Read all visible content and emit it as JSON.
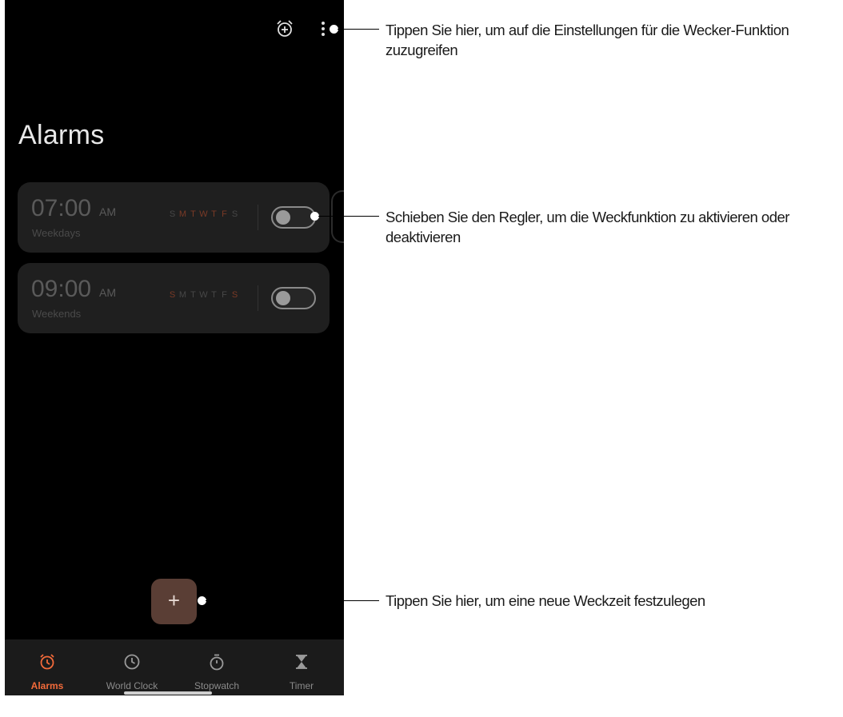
{
  "screen": {
    "title": "Alarms",
    "add_button_label": "+"
  },
  "alarms": [
    {
      "time": "07:00",
      "ampm": "AM",
      "label": "Weekdays",
      "days": [
        "S",
        "M",
        "T",
        "W",
        "T",
        "F",
        "S"
      ],
      "active_days": [
        false,
        true,
        true,
        true,
        true,
        true,
        false
      ],
      "enabled": false
    },
    {
      "time": "09:00",
      "ampm": "AM",
      "label": "Weekends",
      "days": [
        "S",
        "M",
        "T",
        "W",
        "T",
        "F",
        "S"
      ],
      "active_days": [
        true,
        false,
        false,
        false,
        false,
        false,
        true
      ],
      "enabled": false
    }
  ],
  "nav": [
    {
      "label": "Alarms",
      "icon": "alarm-clock-icon",
      "active": true
    },
    {
      "label": "World Clock",
      "icon": "clock-icon",
      "active": false
    },
    {
      "label": "Stopwatch",
      "icon": "stopwatch-icon",
      "active": false
    },
    {
      "label": "Timer",
      "icon": "hourglass-icon",
      "active": false
    }
  ],
  "annotations": {
    "settings": "Tippen Sie hier, um auf die Einstellungen für die Wecker-Funktion zuzugreifen",
    "toggle": "Schieben Sie den Regler, um die Weckfunktion zu aktivieren oder deaktivieren",
    "add": "Tippen Sie hier, um eine neue Weckzeit festzulegen"
  },
  "colors": {
    "accent": "#f26a3a",
    "active_day": "#7a3a26",
    "fab": "#5a3e35",
    "card": "#1f1f1f"
  }
}
